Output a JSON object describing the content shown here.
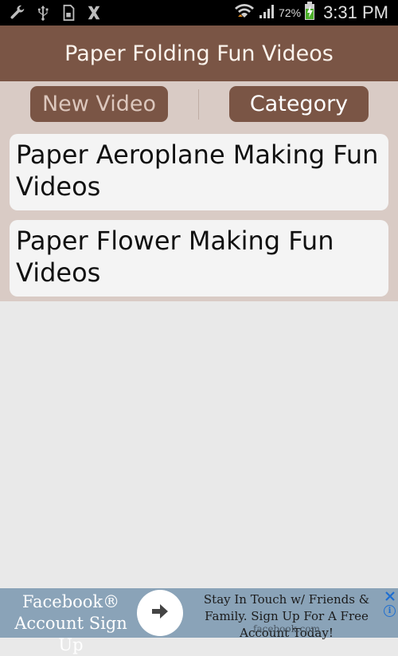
{
  "status_bar": {
    "icons_left": [
      "wrench-icon",
      "usb-icon",
      "sd-card-icon",
      "x-icon"
    ],
    "icons_right": [
      "wifi-icon",
      "signal-icon",
      "battery-charging-icon"
    ],
    "battery_percent": "72%",
    "time": "3:31 PM"
  },
  "app": {
    "title": "Paper Folding Fun Videos",
    "tabs": [
      {
        "label": "New Video"
      },
      {
        "label": "Category"
      }
    ],
    "items": [
      {
        "label": "Paper Aeroplane Making Fun Videos"
      },
      {
        "label": "Paper Flower Making Fun Videos"
      }
    ]
  },
  "ad": {
    "title": "Facebook® Account Sign Up",
    "body": "Stay In Touch w/ Friends & Family. Sign Up For A Free Account Today!",
    "domain": "facebook.com",
    "icons": [
      "arrow-right-icon",
      "close-icon",
      "info-icon"
    ]
  },
  "colors": {
    "primary": "#7a5545",
    "panel_bg": "#d9cbc5",
    "card_bg": "#f4f4f4",
    "page_bg": "#e9e9e9",
    "ad_bg": "#8aa3b8"
  }
}
